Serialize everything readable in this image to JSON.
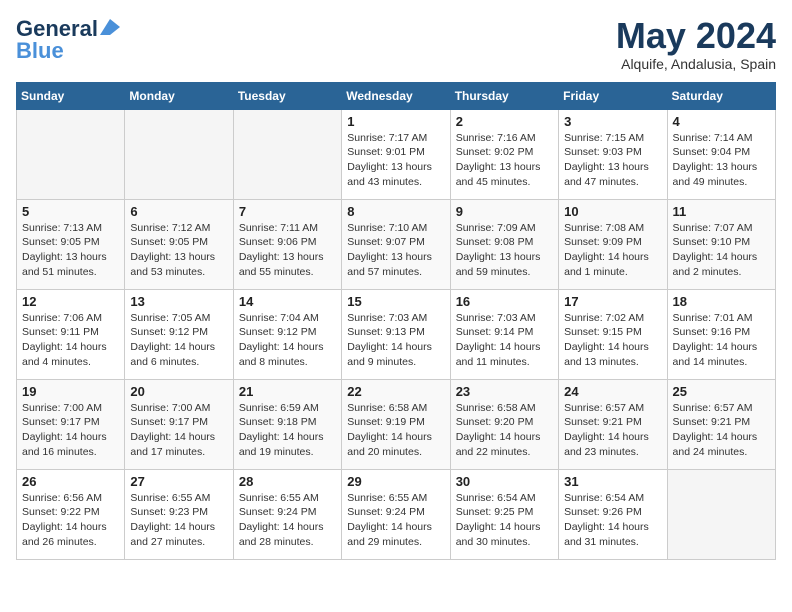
{
  "header": {
    "logo_line1": "General",
    "logo_line2": "Blue",
    "month_title": "May 2024",
    "location": "Alquife, Andalusia, Spain"
  },
  "days_of_week": [
    "Sunday",
    "Monday",
    "Tuesday",
    "Wednesday",
    "Thursday",
    "Friday",
    "Saturday"
  ],
  "weeks": [
    [
      {
        "day": "",
        "info": ""
      },
      {
        "day": "",
        "info": ""
      },
      {
        "day": "",
        "info": ""
      },
      {
        "day": "1",
        "info": "Sunrise: 7:17 AM\nSunset: 9:01 PM\nDaylight: 13 hours\nand 43 minutes."
      },
      {
        "day": "2",
        "info": "Sunrise: 7:16 AM\nSunset: 9:02 PM\nDaylight: 13 hours\nand 45 minutes."
      },
      {
        "day": "3",
        "info": "Sunrise: 7:15 AM\nSunset: 9:03 PM\nDaylight: 13 hours\nand 47 minutes."
      },
      {
        "day": "4",
        "info": "Sunrise: 7:14 AM\nSunset: 9:04 PM\nDaylight: 13 hours\nand 49 minutes."
      }
    ],
    [
      {
        "day": "5",
        "info": "Sunrise: 7:13 AM\nSunset: 9:05 PM\nDaylight: 13 hours\nand 51 minutes."
      },
      {
        "day": "6",
        "info": "Sunrise: 7:12 AM\nSunset: 9:05 PM\nDaylight: 13 hours\nand 53 minutes."
      },
      {
        "day": "7",
        "info": "Sunrise: 7:11 AM\nSunset: 9:06 PM\nDaylight: 13 hours\nand 55 minutes."
      },
      {
        "day": "8",
        "info": "Sunrise: 7:10 AM\nSunset: 9:07 PM\nDaylight: 13 hours\nand 57 minutes."
      },
      {
        "day": "9",
        "info": "Sunrise: 7:09 AM\nSunset: 9:08 PM\nDaylight: 13 hours\nand 59 minutes."
      },
      {
        "day": "10",
        "info": "Sunrise: 7:08 AM\nSunset: 9:09 PM\nDaylight: 14 hours\nand 1 minute."
      },
      {
        "day": "11",
        "info": "Sunrise: 7:07 AM\nSunset: 9:10 PM\nDaylight: 14 hours\nand 2 minutes."
      }
    ],
    [
      {
        "day": "12",
        "info": "Sunrise: 7:06 AM\nSunset: 9:11 PM\nDaylight: 14 hours\nand 4 minutes."
      },
      {
        "day": "13",
        "info": "Sunrise: 7:05 AM\nSunset: 9:12 PM\nDaylight: 14 hours\nand 6 minutes."
      },
      {
        "day": "14",
        "info": "Sunrise: 7:04 AM\nSunset: 9:12 PM\nDaylight: 14 hours\nand 8 minutes."
      },
      {
        "day": "15",
        "info": "Sunrise: 7:03 AM\nSunset: 9:13 PM\nDaylight: 14 hours\nand 9 minutes."
      },
      {
        "day": "16",
        "info": "Sunrise: 7:03 AM\nSunset: 9:14 PM\nDaylight: 14 hours\nand 11 minutes."
      },
      {
        "day": "17",
        "info": "Sunrise: 7:02 AM\nSunset: 9:15 PM\nDaylight: 14 hours\nand 13 minutes."
      },
      {
        "day": "18",
        "info": "Sunrise: 7:01 AM\nSunset: 9:16 PM\nDaylight: 14 hours\nand 14 minutes."
      }
    ],
    [
      {
        "day": "19",
        "info": "Sunrise: 7:00 AM\nSunset: 9:17 PM\nDaylight: 14 hours\nand 16 minutes."
      },
      {
        "day": "20",
        "info": "Sunrise: 7:00 AM\nSunset: 9:17 PM\nDaylight: 14 hours\nand 17 minutes."
      },
      {
        "day": "21",
        "info": "Sunrise: 6:59 AM\nSunset: 9:18 PM\nDaylight: 14 hours\nand 19 minutes."
      },
      {
        "day": "22",
        "info": "Sunrise: 6:58 AM\nSunset: 9:19 PM\nDaylight: 14 hours\nand 20 minutes."
      },
      {
        "day": "23",
        "info": "Sunrise: 6:58 AM\nSunset: 9:20 PM\nDaylight: 14 hours\nand 22 minutes."
      },
      {
        "day": "24",
        "info": "Sunrise: 6:57 AM\nSunset: 9:21 PM\nDaylight: 14 hours\nand 23 minutes."
      },
      {
        "day": "25",
        "info": "Sunrise: 6:57 AM\nSunset: 9:21 PM\nDaylight: 14 hours\nand 24 minutes."
      }
    ],
    [
      {
        "day": "26",
        "info": "Sunrise: 6:56 AM\nSunset: 9:22 PM\nDaylight: 14 hours\nand 26 minutes."
      },
      {
        "day": "27",
        "info": "Sunrise: 6:55 AM\nSunset: 9:23 PM\nDaylight: 14 hours\nand 27 minutes."
      },
      {
        "day": "28",
        "info": "Sunrise: 6:55 AM\nSunset: 9:24 PM\nDaylight: 14 hours\nand 28 minutes."
      },
      {
        "day": "29",
        "info": "Sunrise: 6:55 AM\nSunset: 9:24 PM\nDaylight: 14 hours\nand 29 minutes."
      },
      {
        "day": "30",
        "info": "Sunrise: 6:54 AM\nSunset: 9:25 PM\nDaylight: 14 hours\nand 30 minutes."
      },
      {
        "day": "31",
        "info": "Sunrise: 6:54 AM\nSunset: 9:26 PM\nDaylight: 14 hours\nand 31 minutes."
      },
      {
        "day": "",
        "info": ""
      }
    ]
  ]
}
